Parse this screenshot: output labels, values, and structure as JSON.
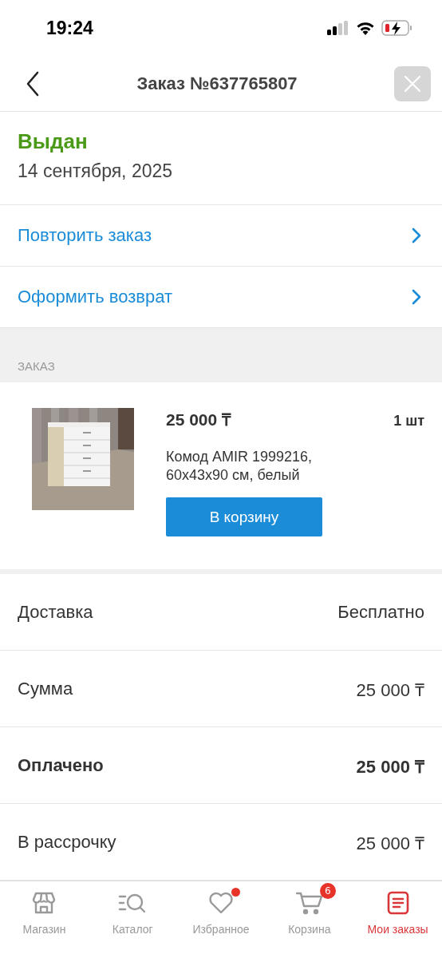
{
  "status_bar": {
    "time": "19:24"
  },
  "header": {
    "title": "Заказ №637765807"
  },
  "order_status": {
    "label": "Выдан",
    "date": "14 сентября, 2025"
  },
  "actions": [
    {
      "label": "Повторить заказ"
    },
    {
      "label": "Оформить возврат"
    }
  ],
  "section_title": "ЗАКАЗ",
  "product": {
    "kind": "picture",
    "price": "25 000 ₸",
    "quantity": "1 шт",
    "name": "Комод AMIR 1999216, 60x43x90 см, белый",
    "button": "В корзину"
  },
  "summary": [
    {
      "label": "Доставка",
      "value": "Бесплатно",
      "bold": false
    },
    {
      "label": "Сумма",
      "value": "25 000 ₸",
      "bold": false
    },
    {
      "label": "Оплачено",
      "value": "25 000 ₸",
      "bold": true
    },
    {
      "label": "В рассрочку",
      "value": "25 000 ₸",
      "bold": false
    }
  ],
  "tab_bar": [
    {
      "kind": "shop",
      "label": "Магазин",
      "selected": false,
      "dot": false
    },
    {
      "kind": "catalog",
      "label": "Каталог",
      "selected": false,
      "dot": false
    },
    {
      "kind": "favorites",
      "label": "Избранное",
      "selected": false,
      "dot": true
    },
    {
      "kind": "cart",
      "label": "Корзина",
      "selected": false,
      "dot": false,
      "badge": "6"
    },
    {
      "kind": "orders",
      "label": "Мои заказы",
      "selected": true,
      "dot": false
    }
  ]
}
